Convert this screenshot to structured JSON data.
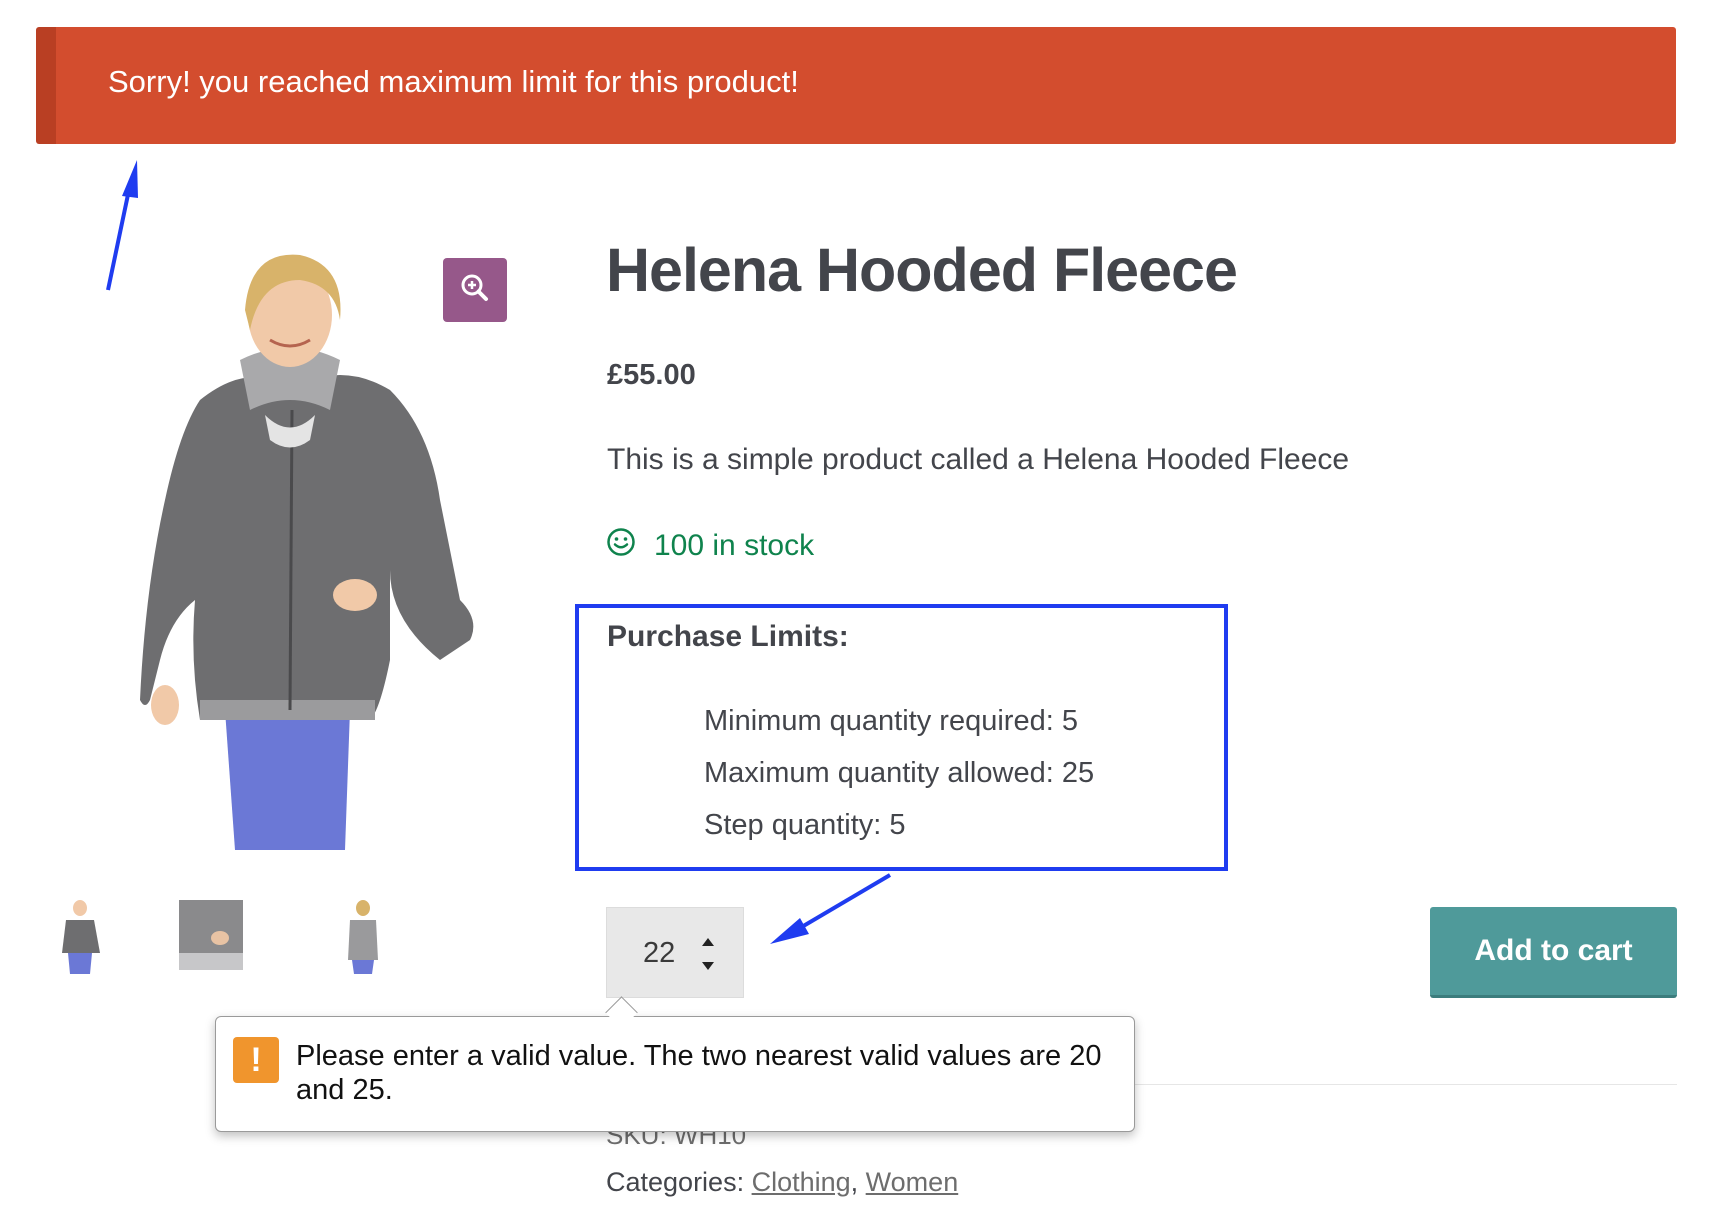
{
  "notice": {
    "message": "Sorry! you reached maximum limit for this product!"
  },
  "product": {
    "title": "Helena Hooded Fleece",
    "price": "£55.00",
    "description": "This is a simple product called a Helena Hooded Fleece",
    "stock": "100 in stock",
    "quantity": "22",
    "add_to_cart": "Add to cart",
    "sku": "SKU: WH10",
    "categories_label": "Categories:",
    "categories": [
      "Clothing",
      "Women"
    ]
  },
  "limits": {
    "title": "Purchase Limits:",
    "items": [
      "Minimum quantity required: 5",
      "Maximum quantity allowed: 25",
      "Step quantity: 5"
    ]
  },
  "validation": {
    "message": "Please enter a valid value. The two nearest valid values are 20 and 25."
  },
  "colors": {
    "notice_bg": "#d34d2e",
    "zoom_button": "#96588a",
    "stock_green": "#0f834d",
    "add_to_cart_bg": "#4f9a9a",
    "annotation_blue": "#1f3cf0",
    "warning_orange": "#f0952d"
  }
}
